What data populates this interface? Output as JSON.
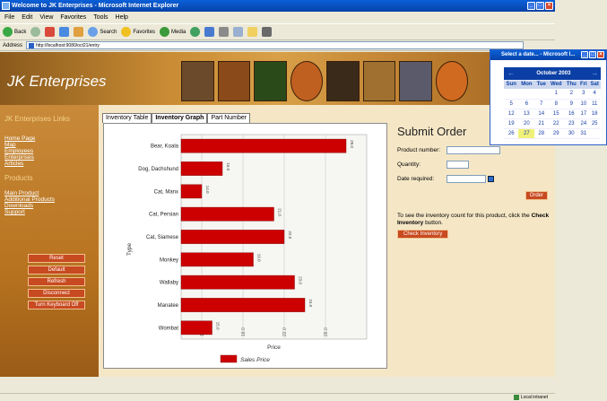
{
  "window": {
    "title": "Welcome to JK Enterprises - Microsoft Internet Explorer"
  },
  "menu": [
    "File",
    "Edit",
    "View",
    "Favorites",
    "Tools",
    "Help"
  ],
  "toolbar": {
    "back": "Back",
    "search": "Search",
    "favorites": "Favorites",
    "media": "Media"
  },
  "address": {
    "label": "Address",
    "url": "http://localhost:9080/oct21/entry",
    "go": "Go"
  },
  "brand": {
    "title": "JK Enterprises"
  },
  "sidebar": {
    "links_heading": "JK Enterprises Links",
    "links": [
      "Home Page",
      "Map",
      "Employees",
      "Enterprises",
      "Articles"
    ],
    "products_heading": "Products",
    "products": [
      "Main Product",
      "Additional Products",
      "Downloads",
      "Support"
    ],
    "buttons": [
      "Reset",
      "Default",
      "Refresh",
      "Disconnect",
      "Turn Keyboard Off"
    ]
  },
  "tabs": [
    "Inventory Table",
    "Inventory Graph",
    "Part Number"
  ],
  "chart_data": {
    "type": "bar",
    "orientation": "horizontal",
    "categories": [
      "Bear, Koala",
      "Dog, Dachshund",
      "Cat, Manx",
      "Cat, Persian",
      "Cat, Siamese",
      "Monkey",
      "Wallaby",
      "Manatee",
      "Wombat"
    ],
    "series": [
      {
        "name": "Sales Price",
        "values": [
          28.0,
          16.0,
          14.0,
          21.0,
          22.0,
          19.0,
          23.0,
          24.0,
          15.0
        ],
        "color": "#cc0000"
      }
    ],
    "value_labels": [
      "28.0",
      "16.0",
      "14.0",
      "21.0",
      "22.0",
      "19.0",
      "23.0",
      "24.0",
      "15.0"
    ],
    "xlim": [
      12,
      30
    ],
    "x_ticks": [
      "14.0",
      "18.0",
      "22.0",
      "26.0"
    ],
    "xlabel": "Price",
    "ylabel": "Type",
    "legend": "bottom",
    "grid": true
  },
  "order": {
    "title": "Submit Order",
    "product_label": "Product number:",
    "quantity_label": "Quantity:",
    "date_label": "Date required:",
    "order_button": "Order",
    "info_prefix": "To see the inventory count for this product, click the ",
    "info_bold": "Check Inventory",
    "info_suffix": " button.",
    "check_button": "Check Inventory"
  },
  "status": {
    "zone": "Local intranet"
  },
  "popup": {
    "title": "Select a date... - Microsoft I...",
    "month": "October 2003",
    "prev": "←",
    "next": "→",
    "weekdays": [
      "Sun",
      "Mon",
      "Tue",
      "Wed",
      "Thu",
      "Fri",
      "Sat"
    ],
    "weeks": [
      [
        "",
        "",
        "",
        "1",
        "2",
        "3",
        "4"
      ],
      [
        "5",
        "6",
        "7",
        "8",
        "9",
        "10",
        "11"
      ],
      [
        "12",
        "13",
        "14",
        "15",
        "16",
        "17",
        "18"
      ],
      [
        "19",
        "20",
        "21",
        "22",
        "23",
        "24",
        "25"
      ],
      [
        "26",
        "27",
        "28",
        "29",
        "30",
        "31",
        ""
      ]
    ],
    "today": "27"
  }
}
